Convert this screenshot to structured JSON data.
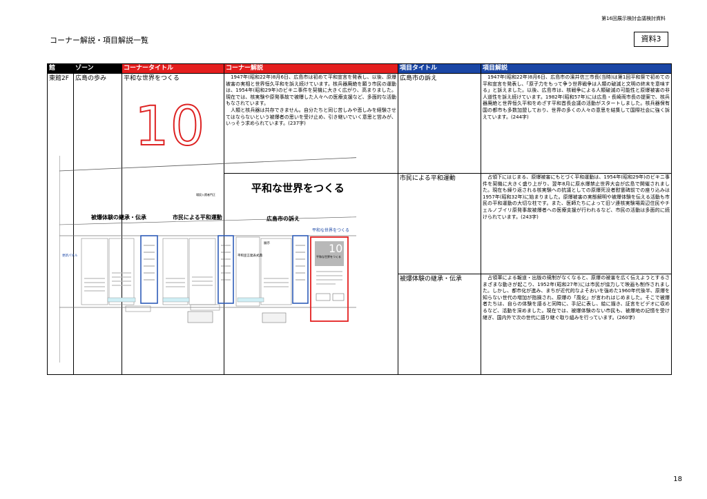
{
  "header_note": "第16回展示検討会議検討資料",
  "doc_title": "コーナー解説・項目解説一覧",
  "ref_label": "資料3",
  "page_number": "18",
  "columns": [
    "館",
    "ゾーン",
    "コーナータイトル",
    "コーナー解説",
    "項目タイトル",
    "項目解説"
  ],
  "row": {
    "building": "東館2F",
    "zone": "広島の歩み",
    "corner_title": "平和な世界をつくる",
    "corner_number": "10",
    "corner_desc": "　1947年(昭和22年)8月6日、広島市は初めて平和宣言を発表し、以後、原爆被害の実相と世界恒久平和を訴え続けています。核兵器廃絶を願う市民の運動は、1954年(昭和29年)のビキニ事件を契機に大きく広がり、高まりました。現在では、核実験や原発事故で被曝した人々への医療支援など、多面的な活動もなされています。\n　人類と核兵器は共存できません。自分たちと同じ苦しみや悲しみを経験させてはならないという被爆者の思いを受け止め、引き継いでいく意思と営みが、いっそう求められています。(237字)"
  },
  "items": [
    {
      "title": "広島市の訴え",
      "desc": "　1947年(昭和22年)8月6日、広島市の濱井信三市長(当時)は第1回平和祭で初めての平和宣言を発表し、「原子力をもって争う世界戦争は人類の破滅と文明の終末を意味する」と訴えました。以後、広島市は、核戦争による人類破滅の可能性と原爆被害の非人道性を訴え続けています。1982年(昭和57年)には広島・長崎両市長の提案で、核兵器廃絶と世界恒久平和をめざす平和首長会議の活動がスタートしました。核兵器保有国の都市も多数加盟しており、世界の多くの人々の意思を結集して国際社会に強く訴えています。(244字)"
    },
    {
      "title": "市民による平和運動",
      "desc": "　占領下にはじまる、原爆被害にもとづく平和運動は、1954年(昭和29年)のビキニ事件を契機に大きく盛り上がり、翌年8月に原水爆禁止世界大会が広島で開催されました。現在も繰り返される核実験への抗議としての原爆死没者慰霊碑前での座り込みは1957年(昭和32年)に始まりました。原爆被害の実態解明や被爆体験を伝える活動も市民の平和運動の大切な柱です。また、医師たちによって旧ソ連核実験場周辺住民やチェルノブイリ原発事故被爆者への医療支援が行われるなど、市民の活動は多面的に続けられています。(243字)"
    },
    {
      "title": "被爆体験の継承・伝承",
      "desc": "　占領軍による報道・出版の規制がなくなると、原爆の被害を広く伝えようとするさまざまな動きが起こり、1952年(昭和27年)には市民が協力して映画も制作されました。しかし、都市化が進み、まちが近代的なよそおいを強めた1960年代後半、原爆を知らない世代の増加が指摘され、原爆の「風化」が言われはじめました。そこで被爆者たちは、自らの体験を語ると同時に、手記に表し、絵に描き、証言をビデオに収めるなど、活動を深めました。現在では、被爆体験のない市民も、被爆地の記憶を受け継ぎ、国内外で次の世代に語り継ぐ取り組みを行っています。(260字)"
    }
  ],
  "floor_plan": {
    "main_title": "平和な世界をつくる",
    "small_note": "増設入館者門正",
    "zone_labels": [
      "被爆体験の継承・伝承",
      "市民による平和運動",
      "広島市の訴え"
    ],
    "corner_tag": "平和な世界をつくる",
    "panel_label": "更新パネル",
    "panel_text_a": "平和宣言発表式典",
    "panel_text_b": "展示",
    "panel_text_c": "平和な世界をつくる",
    "highlight_number": "10"
  }
}
